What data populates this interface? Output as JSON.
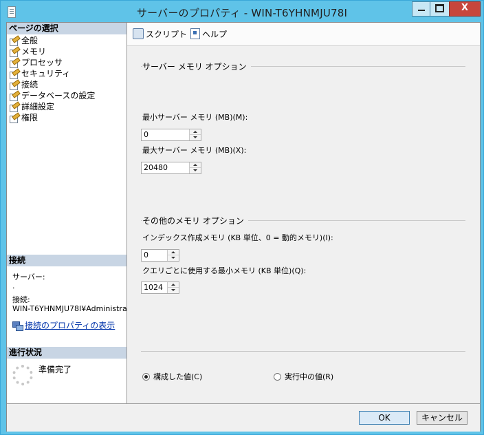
{
  "window": {
    "title": "サーバーのプロパティ - WIN-T6YHNMJU78I",
    "buttons": {
      "minimize": "",
      "maximize": "",
      "close": "X"
    }
  },
  "left_panel": {
    "pages_header": "ページの選択",
    "pages": [
      {
        "label": "全般"
      },
      {
        "label": "メモリ"
      },
      {
        "label": "プロセッサ"
      },
      {
        "label": "セキュリティ"
      },
      {
        "label": "接続"
      },
      {
        "label": "データベースの設定"
      },
      {
        "label": "詳細設定"
      },
      {
        "label": "権限"
      }
    ],
    "connection_header": "接続",
    "server_label": "サーバー:",
    "server_value": ".",
    "connection_label": "接続:",
    "connection_value": "WIN-T6YHNMJU78I¥Administra",
    "view_properties_link": "接続のプロパティの表示",
    "progress_header": "進行状況",
    "progress_status": "準備完了"
  },
  "toolbar": {
    "script_label": "スクリプト",
    "help_label": "ヘルプ"
  },
  "memory": {
    "server_memory_group": "サーバー メモリ オプション",
    "min_label": "最小サーバー メモリ (MB)(M):",
    "min_value": "0",
    "max_label": "最大サーバー メモリ (MB)(X):",
    "max_value": "20480",
    "other_group": "その他のメモリ オプション",
    "index_label": "インデックス作成メモリ (KB 単位、0 = 動的メモリ)(I):",
    "index_value": "0",
    "query_label": "クエリごとに使用する最小メモリ (KB 単位)(Q):",
    "query_value": "1024"
  },
  "options": {
    "configured_label": "構成した値(C)",
    "running_label": "実行中の値(R)",
    "selected": "configured"
  },
  "footer": {
    "ok_label": "OK",
    "cancel_label": "キャンセル"
  }
}
